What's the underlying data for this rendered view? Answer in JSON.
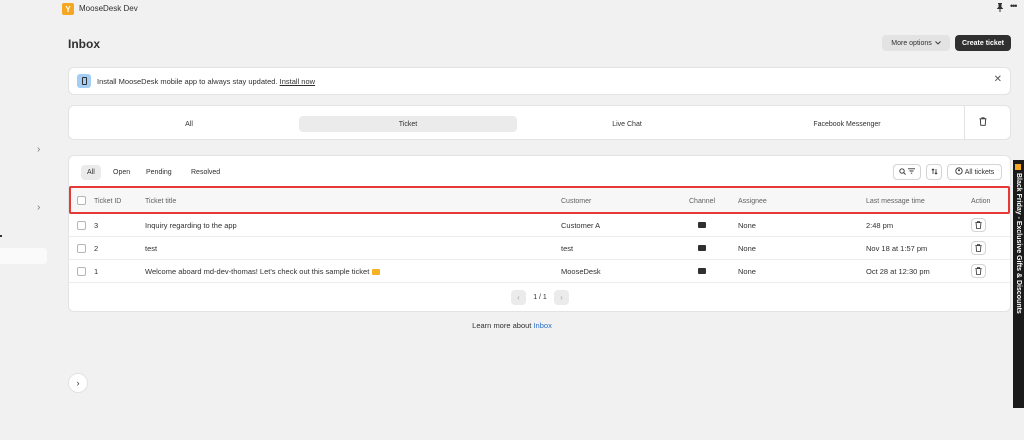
{
  "app": {
    "name": "MooseDesk Dev",
    "logo_letter": "Y"
  },
  "header": {
    "title": "Inbox",
    "more_options_label": "More options",
    "create_ticket_label": "Create ticket"
  },
  "banner": {
    "text": "Install MooseDesk mobile app to always stay updated. ",
    "link": "Install now"
  },
  "channels": [
    {
      "label": "All",
      "active": false
    },
    {
      "label": "Ticket",
      "active": true
    },
    {
      "label": "Live Chat",
      "active": false
    },
    {
      "label": "Facebook Messenger",
      "active": false
    }
  ],
  "status_tabs": [
    {
      "label": "All",
      "active": true
    },
    {
      "label": "Open",
      "active": false
    },
    {
      "label": "Pending",
      "active": false
    },
    {
      "label": "Resolved",
      "active": false
    }
  ],
  "toolbar": {
    "all_tickets_label": "All tickets"
  },
  "table": {
    "columns": [
      "Ticket ID",
      "Ticket title",
      "Customer",
      "Channel",
      "Assignee",
      "Last message time",
      "Action"
    ],
    "rows": [
      {
        "id": "3",
        "title": "Inquiry regarding to the app",
        "customer": "Customer A",
        "assignee": "None",
        "time": "2:48 pm"
      },
      {
        "id": "2",
        "title": "test",
        "customer": "test",
        "assignee": "None",
        "time": "Nov 18 at 1:57 pm"
      },
      {
        "id": "1",
        "title": "Welcome aboard md-dev-thomas! Let's check out this sample ticket",
        "customer": "MooseDesk",
        "assignee": "None",
        "time": "Oct 28 at 12:30 pm"
      }
    ]
  },
  "pagination": {
    "text": "1 / 1"
  },
  "footer": {
    "text": "Learn more about ",
    "link": "Inbox"
  },
  "promo": {
    "text": "Black Friday - Exclusive Gifts & Discounts"
  },
  "colors": {
    "accent": "#f5a623",
    "highlight": "#e53935",
    "link": "#2c6ecb",
    "primary_button": "#303030"
  }
}
